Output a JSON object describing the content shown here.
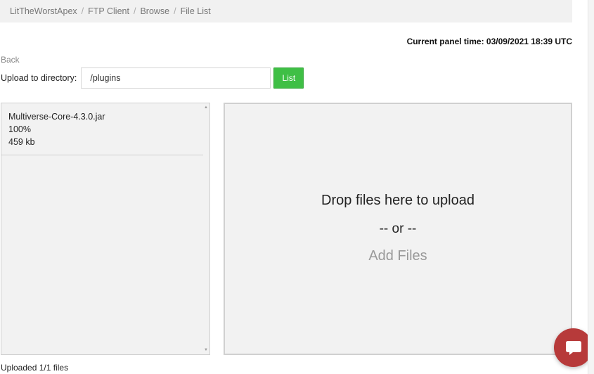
{
  "breadcrumb": [
    "LitTheWorstApex",
    "FTP Client",
    "Browse",
    "File List"
  ],
  "breadcrumb_separator": "/",
  "panel_time": "Current panel time: 03/09/2021 18:39 UTC",
  "back_label": "Back",
  "upload": {
    "label": "Upload to directory:",
    "directory_value": "/plugins",
    "list_button": "List"
  },
  "files": [
    {
      "name": "Multiverse-Core-4.3.0.jar",
      "progress": "100%",
      "size": "459 kb"
    }
  ],
  "dropzone": {
    "drop_text": "Drop files here to upload",
    "or_text": "-- or --",
    "add_files": "Add Files"
  },
  "status": "Uploaded 1/1 files",
  "colors": {
    "list_button": "#3fbf45",
    "chat_button": "#b73a3a"
  }
}
